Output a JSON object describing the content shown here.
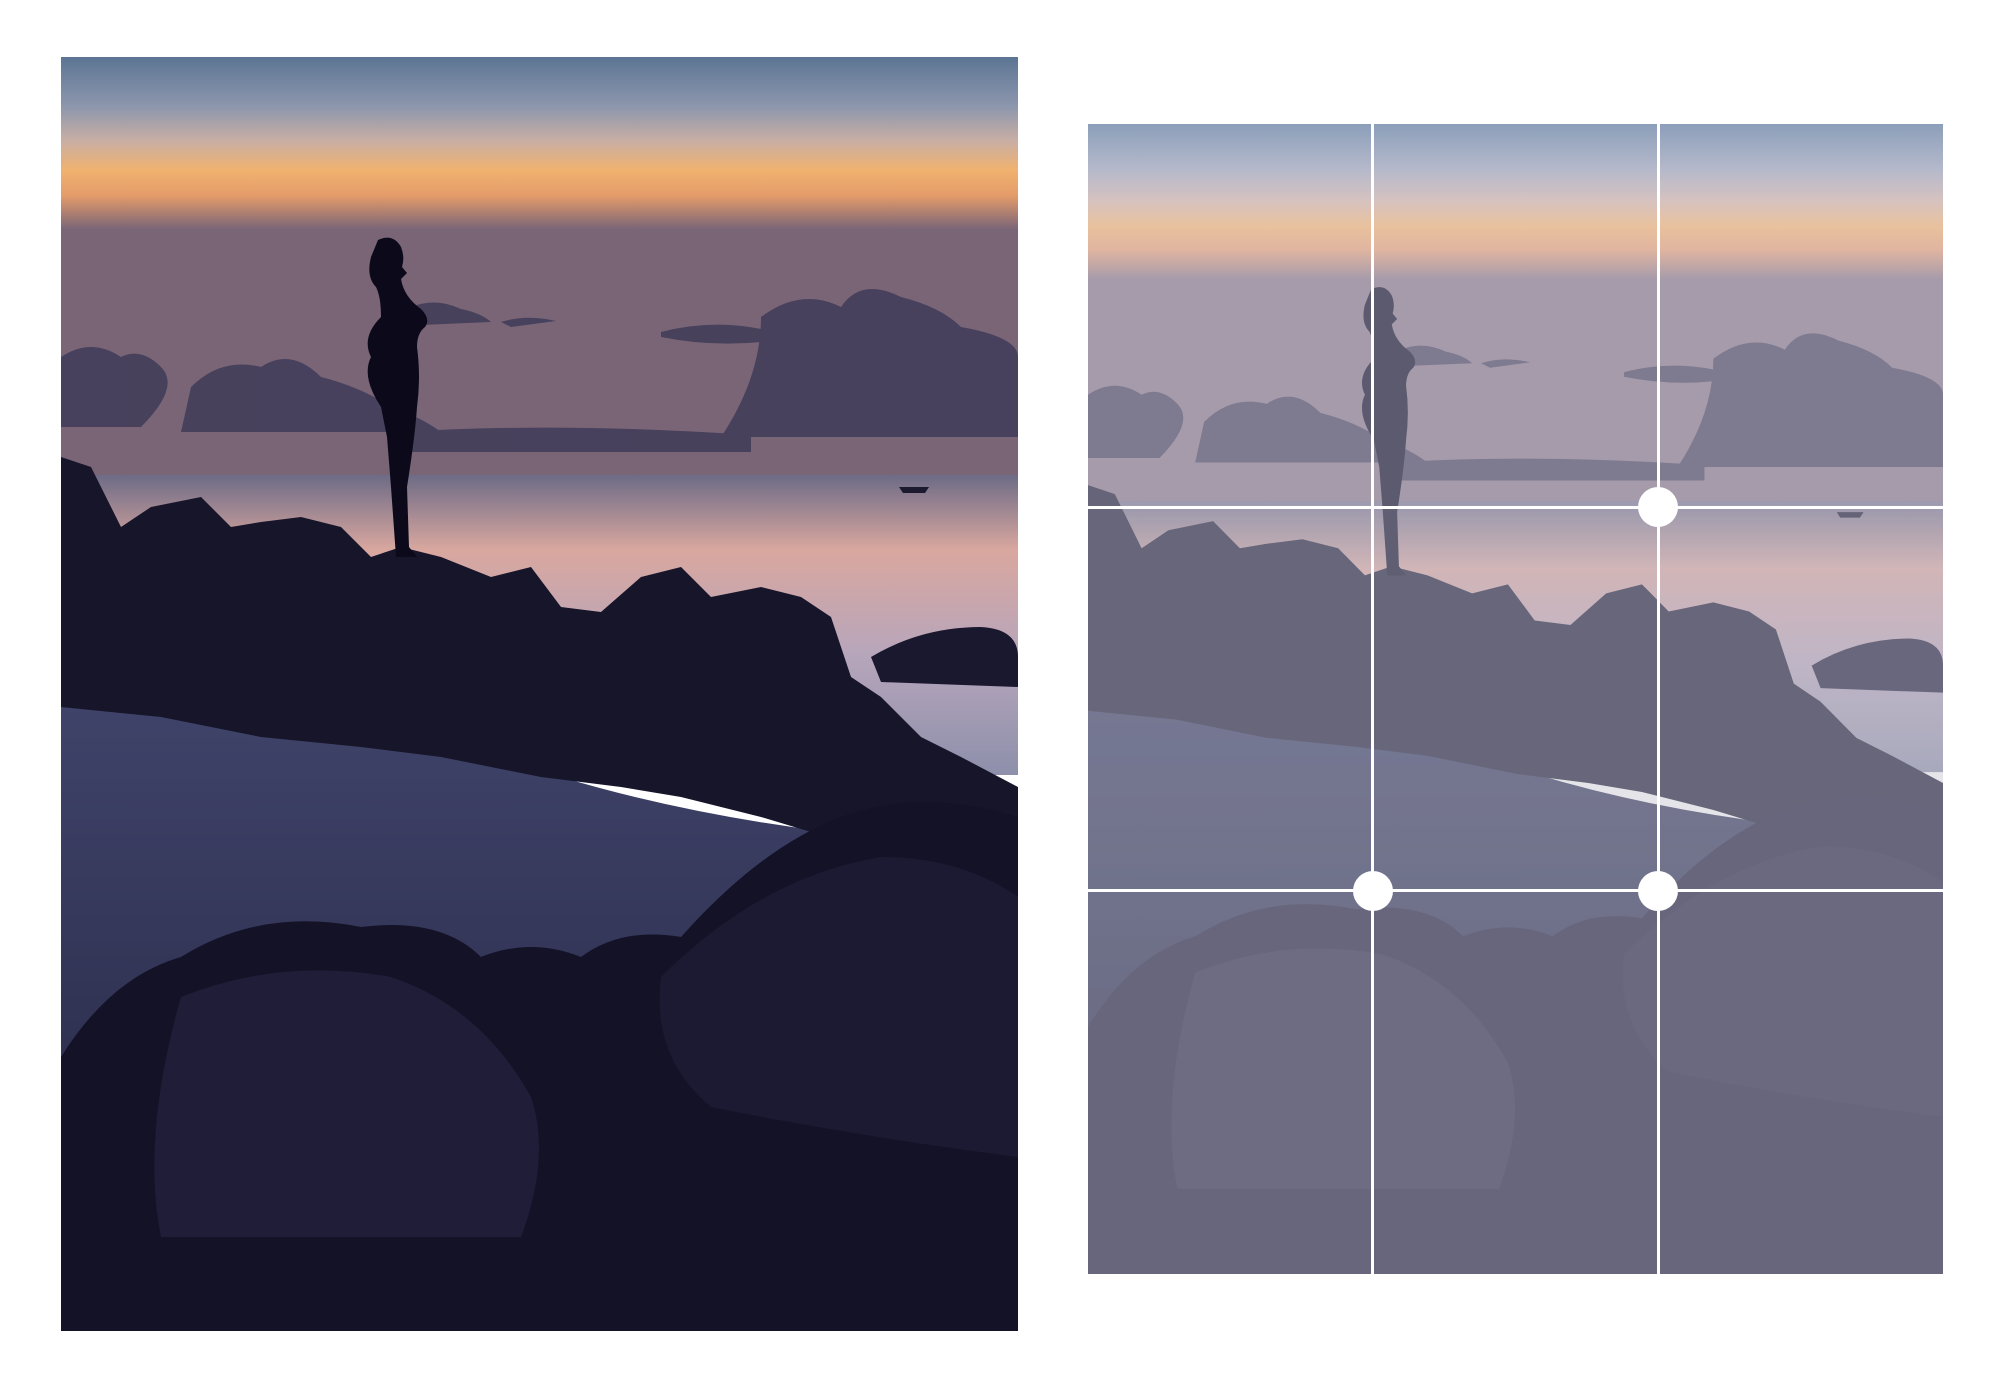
{
  "image": {
    "subject": "silhouette-on-rocks-at-sunset",
    "colors": {
      "sky_top": "#5f7897",
      "sky_mid": "#a9a3b6",
      "sky_glow": "#f1b06e",
      "sea": "#c8a9b4",
      "silhouette": "#0e0c1e",
      "rocks": "#1b1a31",
      "beach": "#3a3d60"
    }
  },
  "overlay": {
    "type": "rule-of-thirds-grid",
    "line_color": "#ffffff",
    "divisions": 3,
    "highlighted_intersections": [
      "top-right",
      "bottom-left",
      "bottom-right"
    ]
  }
}
